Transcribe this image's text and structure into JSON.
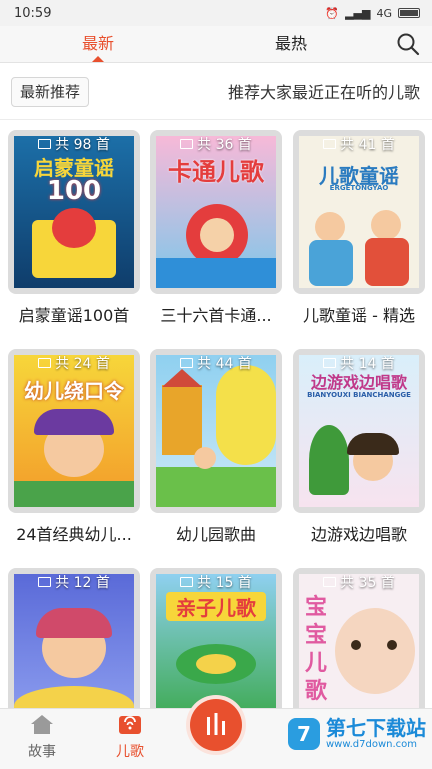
{
  "status": {
    "time": "10:59",
    "network": "4G"
  },
  "tabs": [
    {
      "label": "最新",
      "active": true
    },
    {
      "label": "最热",
      "active": false
    }
  ],
  "recommend": {
    "tag": "最新推荐",
    "description": "推荐大家最近正在听的儿歌"
  },
  "albums": [
    {
      "count": "共 98 首",
      "title": "启蒙童谣100首",
      "cover_text": "启蒙童谣",
      "cover_sub": "100",
      "colors": [
        "#1c6fa8",
        "#f7d63a"
      ]
    },
    {
      "count": "共 36 首",
      "title": "三十六首卡通...",
      "cover_text": "卡通儿歌",
      "cover_sub": "",
      "colors": [
        "#f2a1c8",
        "#e43d3d"
      ]
    },
    {
      "count": "共 41 首",
      "title": "儿歌童谣 - 精选",
      "cover_text": "儿歌童谣",
      "cover_sub": "ERGETONGYAO",
      "colors": [
        "#f5f1e4",
        "#6aaf3d"
      ]
    },
    {
      "count": "共 24 首",
      "title": "24首经典幼儿...",
      "cover_text": "幼儿绕口令",
      "cover_sub": "",
      "colors": [
        "#f7c63a",
        "#e86a2a"
      ]
    },
    {
      "count": "共 44 首",
      "title": "幼儿园歌曲",
      "cover_text": "",
      "cover_sub": "",
      "colors": [
        "#7bc4e8",
        "#e8a52a"
      ]
    },
    {
      "count": "共 14 首",
      "title": "边游戏边唱歌",
      "cover_text": "边游戏边唱歌",
      "cover_sub": "BIANYOUXI BIANCHANGGE",
      "colors": [
        "#c9e6f7",
        "#c0398a"
      ]
    },
    {
      "count": "共 12 首",
      "title": "",
      "cover_text": "",
      "cover_sub": "",
      "colors": [
        "#6f7fe0",
        "#f7b9c8"
      ]
    },
    {
      "count": "共 15 首",
      "title": "",
      "cover_text": "亲子儿歌",
      "cover_sub": "",
      "colors": [
        "#3aa84a",
        "#f7d63a"
      ]
    },
    {
      "count": "共 35 首",
      "title": "",
      "cover_text": "宝宝儿歌",
      "cover_sub": "",
      "colors": [
        "#f7e7ee",
        "#e05aa0"
      ]
    }
  ],
  "bottom_nav": [
    {
      "label": "故事",
      "active": false
    },
    {
      "label": "儿歌",
      "active": true
    }
  ],
  "watermark": {
    "name": "第七下载站",
    "url": "www.d7down.com",
    "logo": "7"
  },
  "accent_color": "#e8502e"
}
